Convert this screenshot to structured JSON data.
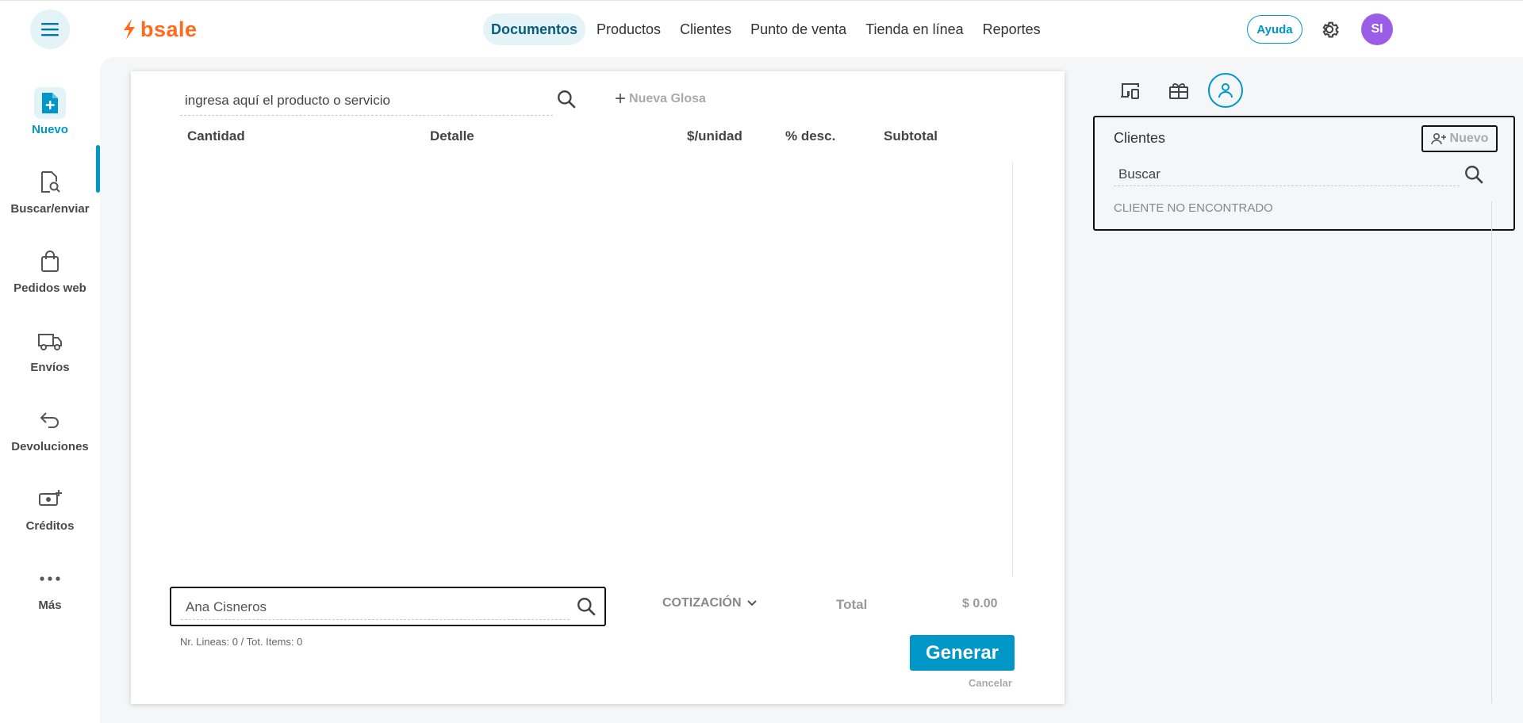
{
  "brand": {
    "name": "bsale",
    "color": "#ff6b1a"
  },
  "header": {
    "nav": [
      "Documentos",
      "Productos",
      "Clientes",
      "Punto de venta",
      "Tienda en línea",
      "Reportes"
    ],
    "active_nav": "Documentos",
    "help_label": "Ayuda",
    "user_initials": "SI",
    "accent": "#0096c7",
    "avatar_color": "#9b5de5"
  },
  "sidebar": {
    "items": [
      {
        "label": "Nuevo",
        "icon": "new-document-icon",
        "active": true
      },
      {
        "label": "Buscar/enviar",
        "icon": "search-document-icon"
      },
      {
        "label": "Pedidos web",
        "icon": "shopping-bag-icon"
      },
      {
        "label": "Envíos",
        "icon": "truck-icon"
      },
      {
        "label": "Devoluciones",
        "icon": "return-arrow-icon"
      },
      {
        "label": "Créditos",
        "icon": "money-add-icon"
      },
      {
        "label": "Más",
        "icon": "more-dots-icon"
      }
    ]
  },
  "document": {
    "product_search_value": "ingresa aquí el producto o servicio",
    "new_gloss_label": "Nueva Glosa",
    "columns": [
      "Cantidad",
      "Detalle",
      "$/unidad",
      "% desc.",
      "Subtotal"
    ],
    "client_value": "Ana Cisneros",
    "doc_type": "COTIZACIÓN",
    "total_label": "Total",
    "total_value": "$ 0.00",
    "counts": "Nr. Lineas: 0 / Tot. Items: 0",
    "generate_label": "Generar",
    "cancel_label": "Cancelar"
  },
  "clients_panel": {
    "title": "Clientes",
    "new_label": "Nuevo",
    "search_value": "Buscar",
    "status": "CLIENTE NO ENCONTRADO"
  }
}
